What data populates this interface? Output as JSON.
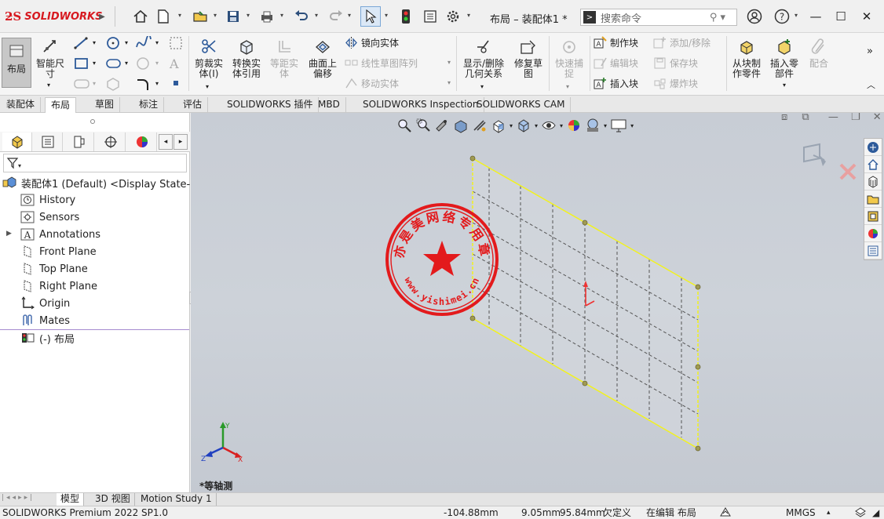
{
  "app": {
    "brand": "SOLIDWORKS",
    "doc_title": "布局 – 装配体1 *",
    "search_placeholder": "搜索命令"
  },
  "ribbon": {
    "layout": "布局",
    "smart_dim": "智能尺\n寸",
    "trim": "剪裁实\n体(I)",
    "convert": "转换实\n体引用",
    "offset_disabled": "等距实\n体",
    "surface_offset": "曲面上\n偏移",
    "mirror": "镜向实体",
    "linear_pattern": "线性草图阵列",
    "move": "移动实体",
    "show_delete": "显示/删除\n几何关系",
    "repair": "修复草\n图",
    "quick_snap": "快速捕\n捉",
    "make_block": "制作块",
    "edit_block": "编辑块",
    "insert_block": "插入块",
    "add_remove": "添加/移除",
    "save_block": "保存块",
    "explode_block": "爆炸块",
    "make_part": "从块制\n作零件",
    "insert_part": "插入零\n部件",
    "mate": "配合"
  },
  "cm_tabs": [
    "装配体",
    "布局",
    "草图",
    "标注",
    "评估",
    "SOLIDWORKS 插件",
    "MBD",
    "SOLIDWORKS Inspection",
    "SOLIDWORKS CAM"
  ],
  "active_cm_tab": "布局",
  "tree": {
    "root": "装配体1 (Default) <Display State-1>",
    "items": [
      "History",
      "Sensors",
      "Annotations",
      "Front Plane",
      "Top Plane",
      "Right Plane",
      "Origin",
      "Mates",
      "(-) 布局"
    ]
  },
  "graphics": {
    "view_label": "*等轴测",
    "stamp_text": "亦是美网络专用章",
    "stamp_url": "www.yishimei.cn"
  },
  "bottom_tabs": [
    "模型",
    "3D 视图",
    "Motion Study 1"
  ],
  "status": {
    "product": "SOLIDWORKS Premium 2022 SP1.0",
    "x": "-104.88mm",
    "y": "9.05mm",
    "z": "95.84mm",
    "state": "欠定义",
    "editing": "在编辑 布局",
    "units": "MMGS"
  },
  "colors": {
    "brand": "#d71920",
    "stamp": "#e31a1c",
    "sketch_line": "#f2f21e",
    "graphics_bg": "#cbd0d7"
  }
}
